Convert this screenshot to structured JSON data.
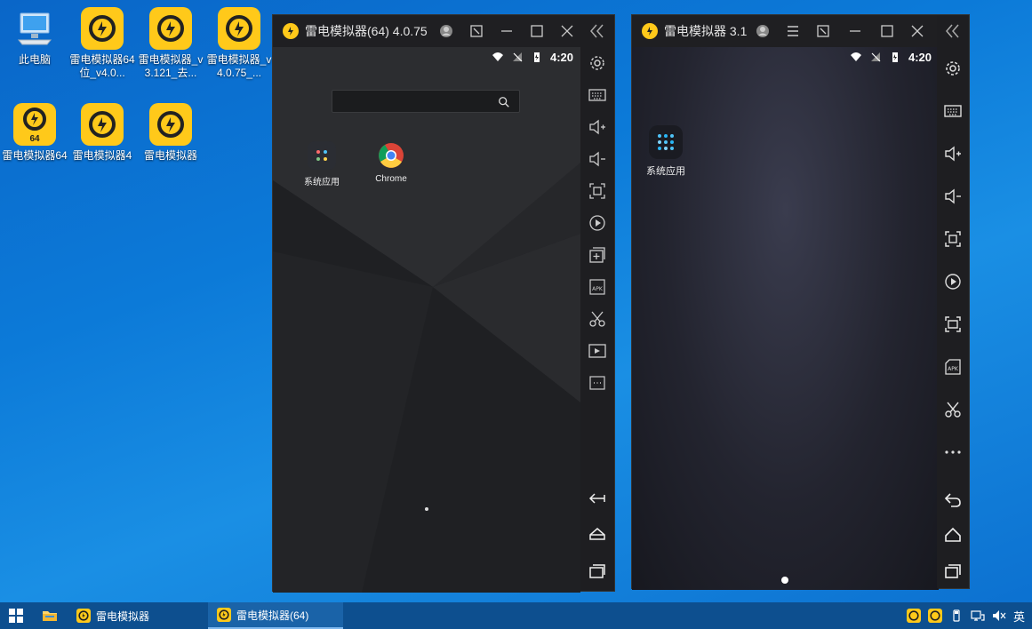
{
  "desktop": {
    "icons": [
      {
        "label": "此电脑"
      },
      {
        "label": "雷电模拟器64位_v4.0..."
      },
      {
        "label": "雷电模拟器_v3.121_去..."
      },
      {
        "label": "雷电模拟器_v4.0.75_..."
      },
      {
        "label": "雷电模拟器64",
        "badge": "64"
      },
      {
        "label": "雷电模拟器4"
      },
      {
        "label": "雷电模拟器"
      }
    ]
  },
  "window1": {
    "title": "雷电模拟器(64) 4.0.75",
    "time": "4:20",
    "apps": [
      {
        "label": "系统应用",
        "icon": "app-grid-icon"
      },
      {
        "label": "Chrome",
        "icon": "chrome-icon"
      }
    ]
  },
  "window2": {
    "title": "雷电模拟器 3.1",
    "time": "4:20",
    "apps": [
      {
        "label": "系统应用",
        "icon": "app-grid-icon"
      }
    ]
  },
  "taskbar": {
    "items": [
      {
        "label": "雷电模拟器"
      },
      {
        "label": "雷电模拟器(64)"
      }
    ],
    "ime": "英"
  },
  "colors": {
    "brand_yellow": "#ffc91a",
    "taskbar": "#0d4f8f",
    "emulator_bg": "#1e1e21"
  }
}
